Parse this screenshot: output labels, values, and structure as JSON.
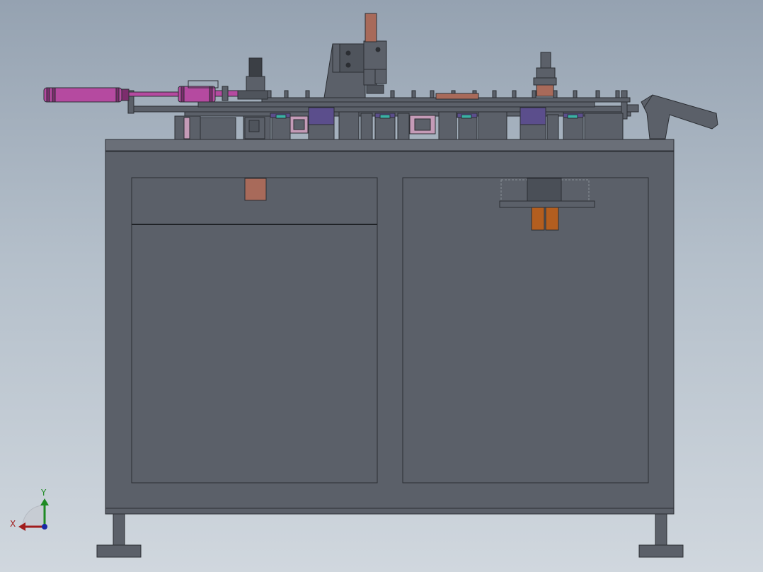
{
  "viewport": {
    "background_top": "#95a2b1",
    "background_bottom": "#d0d7de"
  },
  "colors": {
    "frame": "#5b6069",
    "frame_dark": "#4f545c",
    "frame_edge": "#2b2e33",
    "table_top": "#6a6f78",
    "cylinder": "#b54aa0",
    "cylinder_dark": "#7c2d6d",
    "purple_block": "#5b4e8c",
    "teal_block": "#3bb1a5",
    "copper": "#a86a5a",
    "orange": "#b35e1f",
    "pink_frame": "#c49bb7"
  },
  "machine": {
    "parts": [
      "worktable-frame",
      "left-cabinet-door",
      "left-drawer",
      "right-cabinet-door",
      "feed-rail",
      "pneumatic-cylinder",
      "press-station",
      "discharge-chute",
      "floor-feet"
    ]
  },
  "triad": {
    "y_label": "Y",
    "x_label": "X",
    "icons": [
      "y-axis-arrow-icon",
      "x-axis-arrow-icon",
      "origin-dot-icon"
    ]
  }
}
